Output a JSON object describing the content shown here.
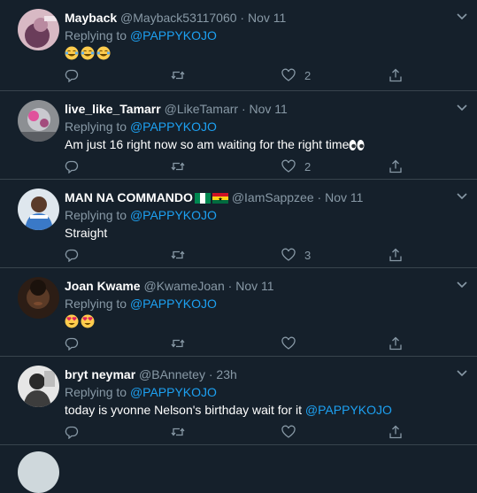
{
  "colors": {
    "background": "#15202b",
    "border": "#38444d",
    "secondary_text": "#8899a6",
    "link": "#1da1f2",
    "primary_text": "#ffffff"
  },
  "tweets": [
    {
      "name": "Mayback",
      "handle": "@Mayback53117060",
      "dot": "·",
      "date": "Nov 11",
      "replying_label": "Replying to",
      "replying_to": "@PAPPYKOJO",
      "text": "",
      "emoji": [
        "joy-emoji",
        "joy-emoji",
        "joy-emoji"
      ],
      "likes": "2"
    },
    {
      "name": "live_like_Tamarr",
      "handle": "@LikeTamarr",
      "dot": "·",
      "date": "Nov 11",
      "replying_label": "Replying to",
      "replying_to": "@PAPPYKOJO",
      "text": "Am just 16 right now so am waiting for the right time",
      "emoji": [
        "eyes-emoji"
      ],
      "likes": "2"
    },
    {
      "name": "MAN NA COMMANDO",
      "handle": "@IamSappzee",
      "dot": "·",
      "date": "Nov 11",
      "replying_label": "Replying to",
      "replying_to": "@PAPPYKOJO",
      "text": "Straight",
      "emoji": [
        "nigeria-flag",
        "ghana-flag"
      ],
      "likes": "3"
    },
    {
      "name": "Joan Kwame",
      "handle": "@KwameJoan",
      "dot": "·",
      "date": "Nov 11",
      "replying_label": "Replying to",
      "replying_to": "@PAPPYKOJO",
      "text": "",
      "emoji": [
        "heart-eyes-emoji",
        "heart-eyes-emoji"
      ],
      "likes": ""
    },
    {
      "name": "bryt neymar",
      "handle": "@BAnnetey",
      "dot": "·",
      "date": "23h",
      "replying_label": "Replying to",
      "replying_to": "@PAPPYKOJO",
      "text": "today is yvonne Nelson's birthday wait for it ",
      "text_mention": "@PAPPYKOJO",
      "emoji": [],
      "likes": ""
    }
  ]
}
